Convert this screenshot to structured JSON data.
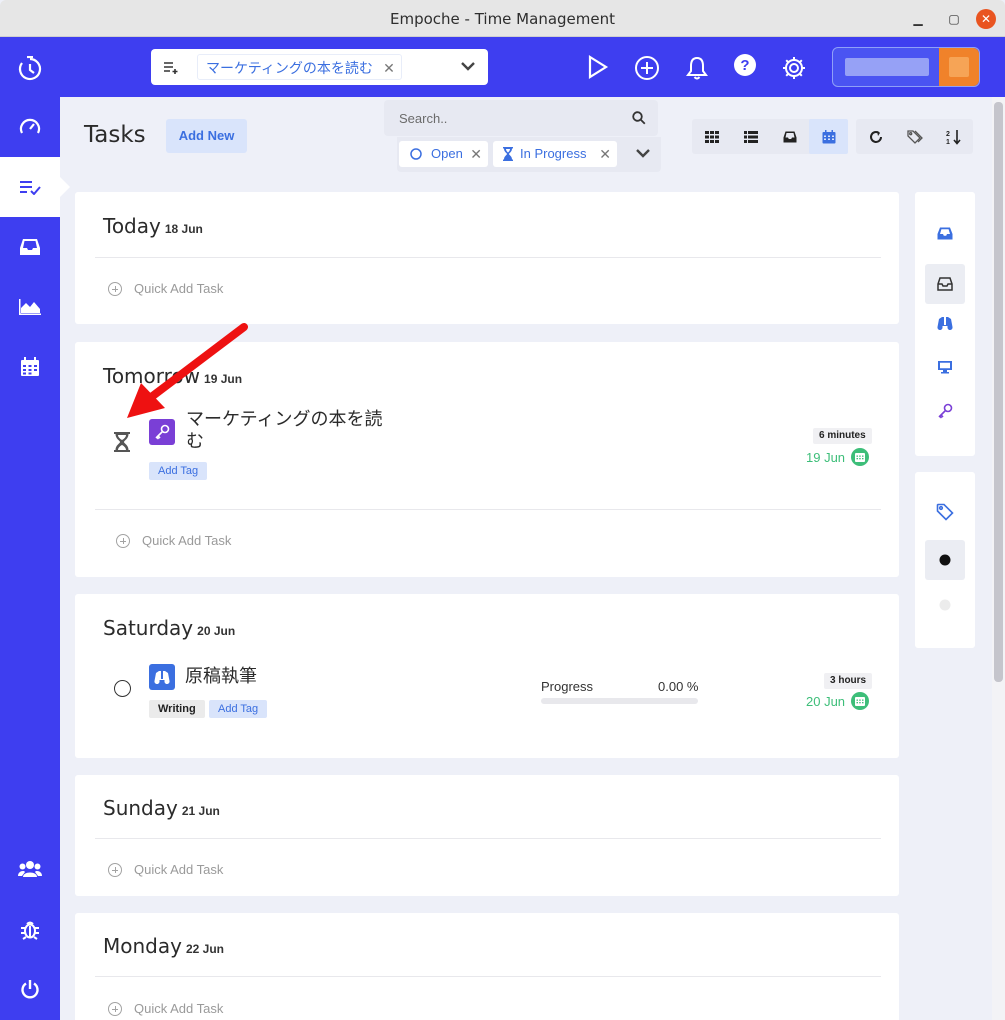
{
  "window": {
    "title": "Empoche - Time Management",
    "minimize": "▁",
    "maximize": "▢",
    "close": "✕"
  },
  "topbar": {
    "current_task": "マーケティングの本を読む",
    "chip_remove": "✕",
    "icons": [
      "play-icon",
      "plus-circle-icon",
      "bell-icon",
      "help-icon",
      "gear-icon"
    ]
  },
  "sidebar": {
    "items": [
      {
        "name": "dashboard",
        "icon": "speedometer-icon"
      },
      {
        "name": "tasks",
        "icon": "task-list-icon",
        "active": true
      },
      {
        "name": "inbox",
        "icon": "inbox-icon"
      },
      {
        "name": "reports",
        "icon": "area-chart-icon"
      },
      {
        "name": "calendar",
        "icon": "calendar-icon"
      },
      {
        "name": "team",
        "icon": "users-icon"
      },
      {
        "name": "bugs",
        "icon": "bug-icon"
      },
      {
        "name": "logout",
        "icon": "power-icon"
      }
    ]
  },
  "header": {
    "title": "Tasks",
    "add_new": "Add New",
    "search_placeholder": "Search..",
    "filters": [
      {
        "label": "Open",
        "icon": "circle-icon"
      },
      {
        "label": "In Progress",
        "icon": "hourglass-icon"
      }
    ],
    "chip_remove": "✕"
  },
  "days": [
    {
      "label": "Today",
      "date": "18 Jun",
      "quick_add": "Quick Add Task"
    },
    {
      "label": "Tomorrow",
      "date": "19 Jun",
      "quick_add": "Quick Add Task",
      "task": {
        "name_line1": "マーケティングの本を読",
        "name_line2": "む",
        "status": "in-progress",
        "icon": "key-icon",
        "icon_color": "#7a3fd6",
        "add_tag": "Add Tag",
        "duration": "6 minutes",
        "due": "19 Jun"
      }
    },
    {
      "label": "Saturday",
      "date": "20 Jun",
      "task": {
        "name": "原稿執筆",
        "status": "open",
        "icon": "binoculars-icon",
        "icon_color": "#3b6fe0",
        "tag": "Writing",
        "add_tag": "Add Tag",
        "progress_label": "Progress",
        "progress_value": "0.00 %",
        "progress_fraction": 0.0,
        "duration": "3 hours",
        "due": "20 Jun"
      }
    },
    {
      "label": "Sunday",
      "date": "21 Jun",
      "quick_add": "Quick Add Task"
    },
    {
      "label": "Monday",
      "date": "22 Jun",
      "quick_add": "Quick Add Task"
    }
  ],
  "right_panel_projects": [
    "inbox-filled-icon",
    "inbox-icon",
    "binoculars-icon",
    "monitor-icon",
    "key-icon"
  ],
  "right_panel_tags": [
    "tag-icon",
    "dot-icon",
    "dot-icon"
  ],
  "colors": {
    "brand": "#3e3ef0",
    "accent": "#3b6fe0",
    "due_green": "#3dbe79",
    "annotation_arrow": "#ee1111"
  }
}
